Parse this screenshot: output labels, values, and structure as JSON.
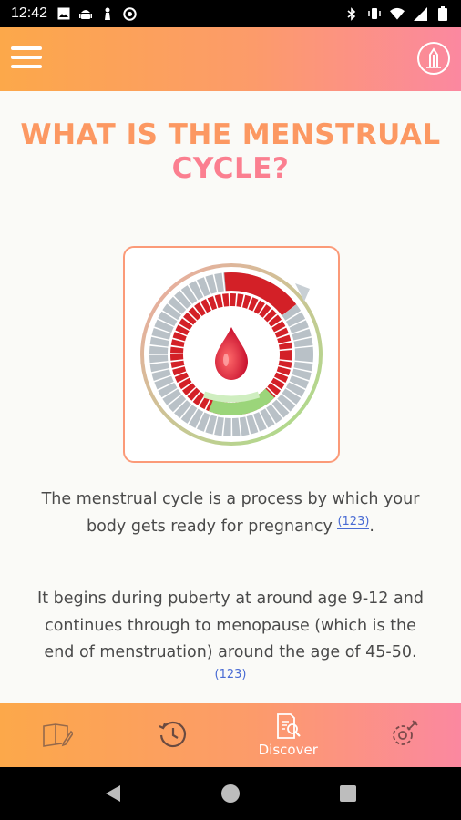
{
  "status_bar": {
    "time": "12:42",
    "left_icons": [
      "image-icon",
      "android-icon",
      "chess-pawn-icon",
      "circle-r-icon"
    ],
    "right_icons": [
      "bluetooth-icon",
      "vibrate-icon",
      "wifi-icon",
      "signal-icon",
      "battery-icon"
    ]
  },
  "app_bar": {
    "menu_icon": "hamburger-menu-icon",
    "logo_icon": "pen-logo-icon",
    "gradient": [
      "#fca84a",
      "#fb88a0"
    ]
  },
  "main": {
    "title_line1": "WHAT IS THE MENSTRUAL",
    "title_line2": "CYCLE?",
    "image_icon": "menstrual-cycle-wheel-icon",
    "paragraph1": {
      "text": "The menstrual cycle is a process by which your body gets ready for pregnancy ",
      "citation": "(123)",
      "suffix": "."
    },
    "paragraph2": {
      "text": "It begins during puberty at around age 9-12 and continues through to menopause (which is the end of menstruation) around the age of 45-50. ",
      "citation": "(123)"
    }
  },
  "bottom_nav": {
    "items": [
      {
        "icon": "book-edit-icon",
        "label": ""
      },
      {
        "icon": "history-clock-icon",
        "label": ""
      },
      {
        "icon": "discover-document-search-icon",
        "label": "Discover"
      },
      {
        "icon": "settings-gear-icon",
        "label": ""
      }
    ],
    "active": "Discover"
  },
  "system_nav": {
    "items": [
      "back-triangle-icon",
      "home-circle-icon",
      "recents-square-icon"
    ]
  }
}
